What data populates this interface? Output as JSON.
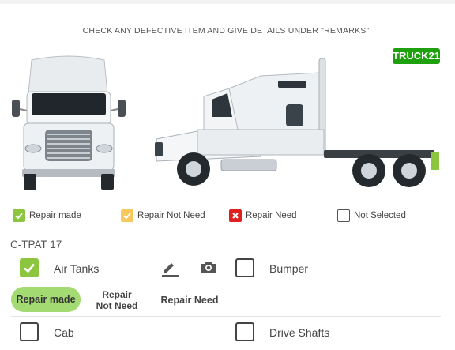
{
  "header": {
    "instruction": "CHECK ANY DEFECTIVE ITEM AND GIVE DETAILS UNDER \"REMARKS\"",
    "truck_id": "TRUCK21"
  },
  "legend": [
    {
      "label": "Repair made",
      "color": "#8cc63f"
    },
    {
      "label": "Repair Not Need",
      "color": "#f7c95c"
    },
    {
      "label": "Repair Need",
      "color": "#e02020"
    },
    {
      "label": "Not Selected",
      "color": "#ffffff"
    }
  ],
  "section": {
    "title": "C-TPAT 17",
    "items": [
      {
        "label": "Air Tanks",
        "checked": true
      },
      {
        "label": "Bumper",
        "checked": false
      },
      {
        "label": "Cab",
        "checked": false
      },
      {
        "label": "Drive Shafts",
        "checked": false
      }
    ],
    "options": {
      "repair_made": "Repair made",
      "repair_not_need": "Repair Not Need",
      "repair_need": "Repair Need"
    }
  },
  "icons": [
    "pencil-icon",
    "camera-icon",
    "check-icon",
    "x-icon"
  ]
}
